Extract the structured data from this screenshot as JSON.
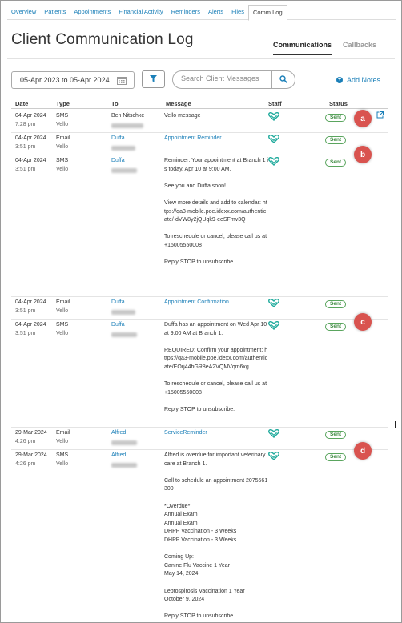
{
  "nav": {
    "tabs": [
      "Overview",
      "Patients",
      "Appointments",
      "Financial Activity",
      "Reminders",
      "Alerts",
      "Files",
      "Comm Log"
    ],
    "active": "Comm Log"
  },
  "page": {
    "title": "Client Communication Log",
    "view_tabs": [
      {
        "label": "Communications",
        "active": true
      },
      {
        "label": "Callbacks",
        "active": false
      }
    ]
  },
  "filters": {
    "date_range": "05-Apr 2023 to 05-Apr 2024",
    "search_placeholder": "Search Client Messages",
    "add_notes_label": "Add Notes"
  },
  "table": {
    "headers": [
      "Date",
      "Type",
      "To",
      "Message",
      "Staff",
      "Status"
    ],
    "rows": [
      {
        "date": "04-Apr 2024",
        "time": "7:28 pm",
        "type": "SMS",
        "channel": "Vello",
        "to": "Ben Nitschke",
        "to_is_link": false,
        "message": [
          "Vello message"
        ],
        "message_is_link": false,
        "status": "Sent"
      },
      {
        "date": "04-Apr 2024",
        "time": "3:51 pm",
        "type": "Email",
        "channel": "Vello",
        "to": "Duffa",
        "to_is_link": true,
        "message": [
          "Appointment Reminder"
        ],
        "message_is_link": true,
        "status": "Sent"
      },
      {
        "date": "04-Apr 2024",
        "time": "3:51 pm",
        "type": "SMS",
        "channel": "Vello",
        "to": "Duffa",
        "to_is_link": true,
        "message": [
          "Reminder: Your appointment at Branch 1 is today, Apr 10 at 9:00 AM.",
          "See you and Duffa soon!",
          "View more details and add to calendar: https://qa3-mobile.poe.idexx.com/authenticate/-dVW8y2jQUqk9-eeSFmv3Q",
          "To reschedule or cancel, please call us at +15005550008",
          "Reply STOP to unsubscribe."
        ],
        "message_is_link": false,
        "status": "Sent"
      },
      {
        "date": "04-Apr 2024",
        "time": "3:51 pm",
        "type": "Email",
        "channel": "Vello",
        "to": "Duffa",
        "to_is_link": true,
        "message": [
          "Appointment Confirmation"
        ],
        "message_is_link": true,
        "status": "Sent"
      },
      {
        "date": "04-Apr 2024",
        "time": "3:51 pm",
        "type": "SMS",
        "channel": "Vello",
        "to": "Duffa",
        "to_is_link": true,
        "message": [
          "Duffa has an appointment on Wed Apr 10 at 9:00 AM at Branch 1.",
          "REQUIRED: Confirm your appointment: https://qa3-mobile.poe.idexx.com/authenticate/EOrj44hGR8eA2VQMVqm6xg",
          "To reschedule or cancel, please call us at +15005550008",
          "Reply STOP to unsubscribe."
        ],
        "message_is_link": false,
        "status": "Sent"
      },
      {
        "date": "29-Mar 2024",
        "time": "4:26 pm",
        "type": "Email",
        "channel": "Vello",
        "to": "Alfred",
        "to_is_link": true,
        "message": [
          "ServiceReminder"
        ],
        "message_is_link": true,
        "status": "Sent"
      },
      {
        "date": "29-Mar 2024",
        "time": "4:26 pm",
        "type": "SMS",
        "channel": "Vello",
        "to": "Alfred",
        "to_is_link": true,
        "message": [
          "Alfred is overdue for important veterinary care at Branch 1.",
          "Call to schedule an appointment 2075561300",
          "*Overdue*\nAnnual Exam\nAnnual Exam\nDHPP Vaccination - 3 Weeks\nDHPP Vaccination - 3 Weeks",
          "Coming Up:\nCanine Flu Vaccine 1 Year\nMay 14, 2024",
          "Leptospirosis Vaccination 1 Year\nOctober 9, 2024",
          "Reply STOP to unsubscribe."
        ],
        "message_is_link": false,
        "status": "Sent"
      }
    ]
  },
  "callouts": [
    "a",
    "b",
    "c",
    "d"
  ],
  "icons": {
    "calendar": "calendar-icon",
    "filter": "filter-icon",
    "search": "search-icon",
    "add": "plus-circle-icon",
    "staff": "staff-heart-icon",
    "external": "external-link-icon"
  },
  "colors": {
    "link": "#1a7fb8",
    "sent_badge": "#5aa55e",
    "staff_icon": "#1faa9c",
    "callout": "#d9534f"
  }
}
